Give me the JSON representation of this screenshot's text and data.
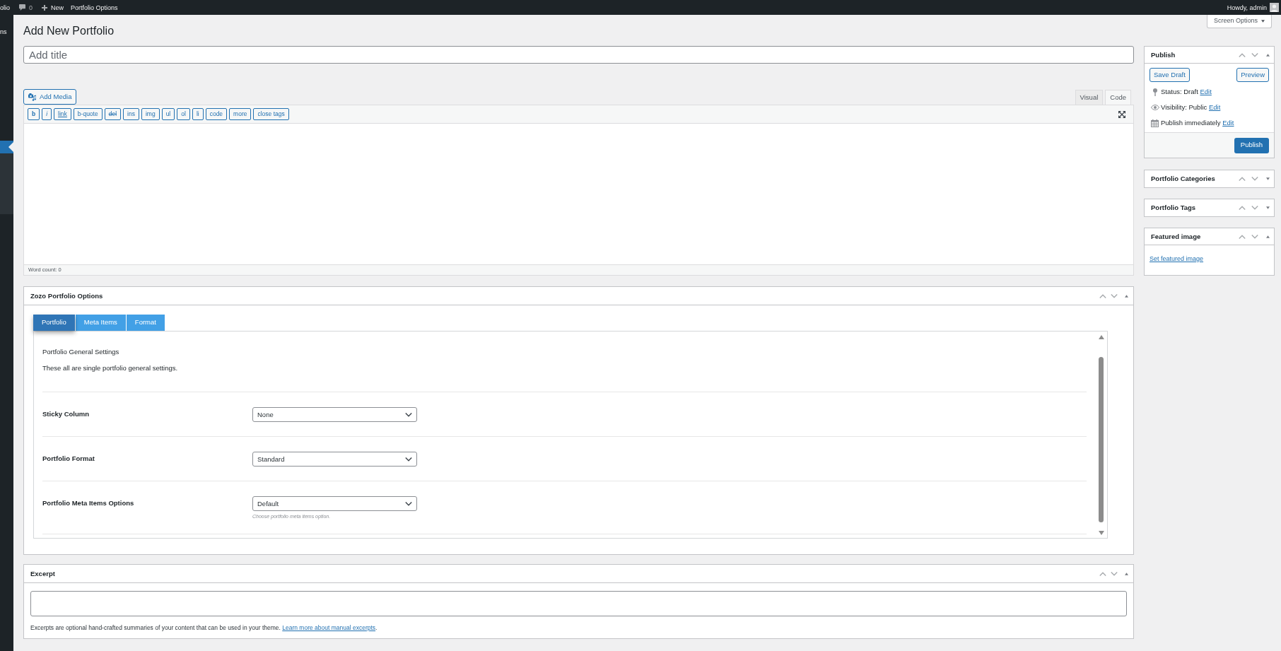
{
  "admin_bar": {
    "site_name": "olio",
    "comments": "0",
    "new": "New",
    "menu": "Portfolio Options",
    "greeting": "Howdy, admin"
  },
  "sidebar": {
    "items": [
      {
        "label": "ns",
        "selected": false
      },
      {
        "selected": true
      }
    ]
  },
  "screen_options": {
    "label": "Screen Options",
    "expanded": false
  },
  "page_title": "Add New Portfolio",
  "title_field": {
    "placeholder": "Add title"
  },
  "editor": {
    "add_media": "Add Media",
    "tabs": [
      {
        "label": "Visual",
        "selected": false
      },
      {
        "label": "Code",
        "selected": true
      }
    ],
    "quicktags": [
      {
        "label": "b",
        "kind": "bold"
      },
      {
        "label": "i",
        "kind": "italic"
      },
      {
        "label": "link",
        "kind": "link"
      },
      {
        "label": "b-quote",
        "kind": "plain"
      },
      {
        "label": "del",
        "kind": "strike"
      },
      {
        "label": "ins",
        "kind": "plain"
      },
      {
        "label": "img",
        "kind": "plain"
      },
      {
        "label": "ul",
        "kind": "plain"
      },
      {
        "label": "ol",
        "kind": "plain"
      },
      {
        "label": "li",
        "kind": "plain"
      },
      {
        "label": "code",
        "kind": "plain"
      },
      {
        "label": "more",
        "kind": "plain"
      },
      {
        "label": "close tags",
        "kind": "plain"
      }
    ],
    "word_count": "Word count: 0"
  },
  "portfolio_options": {
    "title": "Zozo Portfolio Options",
    "expanded": true,
    "tabs": [
      {
        "label": "Portfolio",
        "selected": true
      },
      {
        "label": "Meta Items",
        "selected": false
      },
      {
        "label": "Format",
        "selected": false
      }
    ],
    "section_title": "Portfolio General Settings",
    "section_description": "These all are single portfolio general settings.",
    "fields": [
      {
        "label": "Sticky Column",
        "value": "None"
      },
      {
        "label": "Portfolio Format",
        "value": "Standard"
      },
      {
        "label": "Portfolio Meta Items Options",
        "value": "Default",
        "hint": "Choose portfolio meta items option."
      }
    ]
  },
  "excerpt": {
    "title": "Excerpt",
    "expanded": true,
    "hint": "Excerpts are optional hand-crafted summaries of your content that can be used in your theme.",
    "link": "Learn more about manual excerpts",
    "link_suffix": "."
  },
  "publish": {
    "title": "Publish",
    "expanded": true,
    "save_draft": "Save Draft",
    "preview": "Preview",
    "rows": [
      {
        "kind": "status",
        "text": "Status: Draft",
        "link": "Edit"
      },
      {
        "kind": "visibility",
        "text": "Visibility: Public",
        "link": "Edit"
      },
      {
        "kind": "schedule",
        "text": "Publish immediately",
        "link": "Edit"
      }
    ],
    "publish_button": "Publish"
  },
  "side_boxes": [
    {
      "title": "Portfolio Categories",
      "expanded": false
    },
    {
      "title": "Portfolio Tags",
      "expanded": false
    },
    {
      "title": "Featured image",
      "expanded": true,
      "link": "Set featured image"
    }
  ]
}
